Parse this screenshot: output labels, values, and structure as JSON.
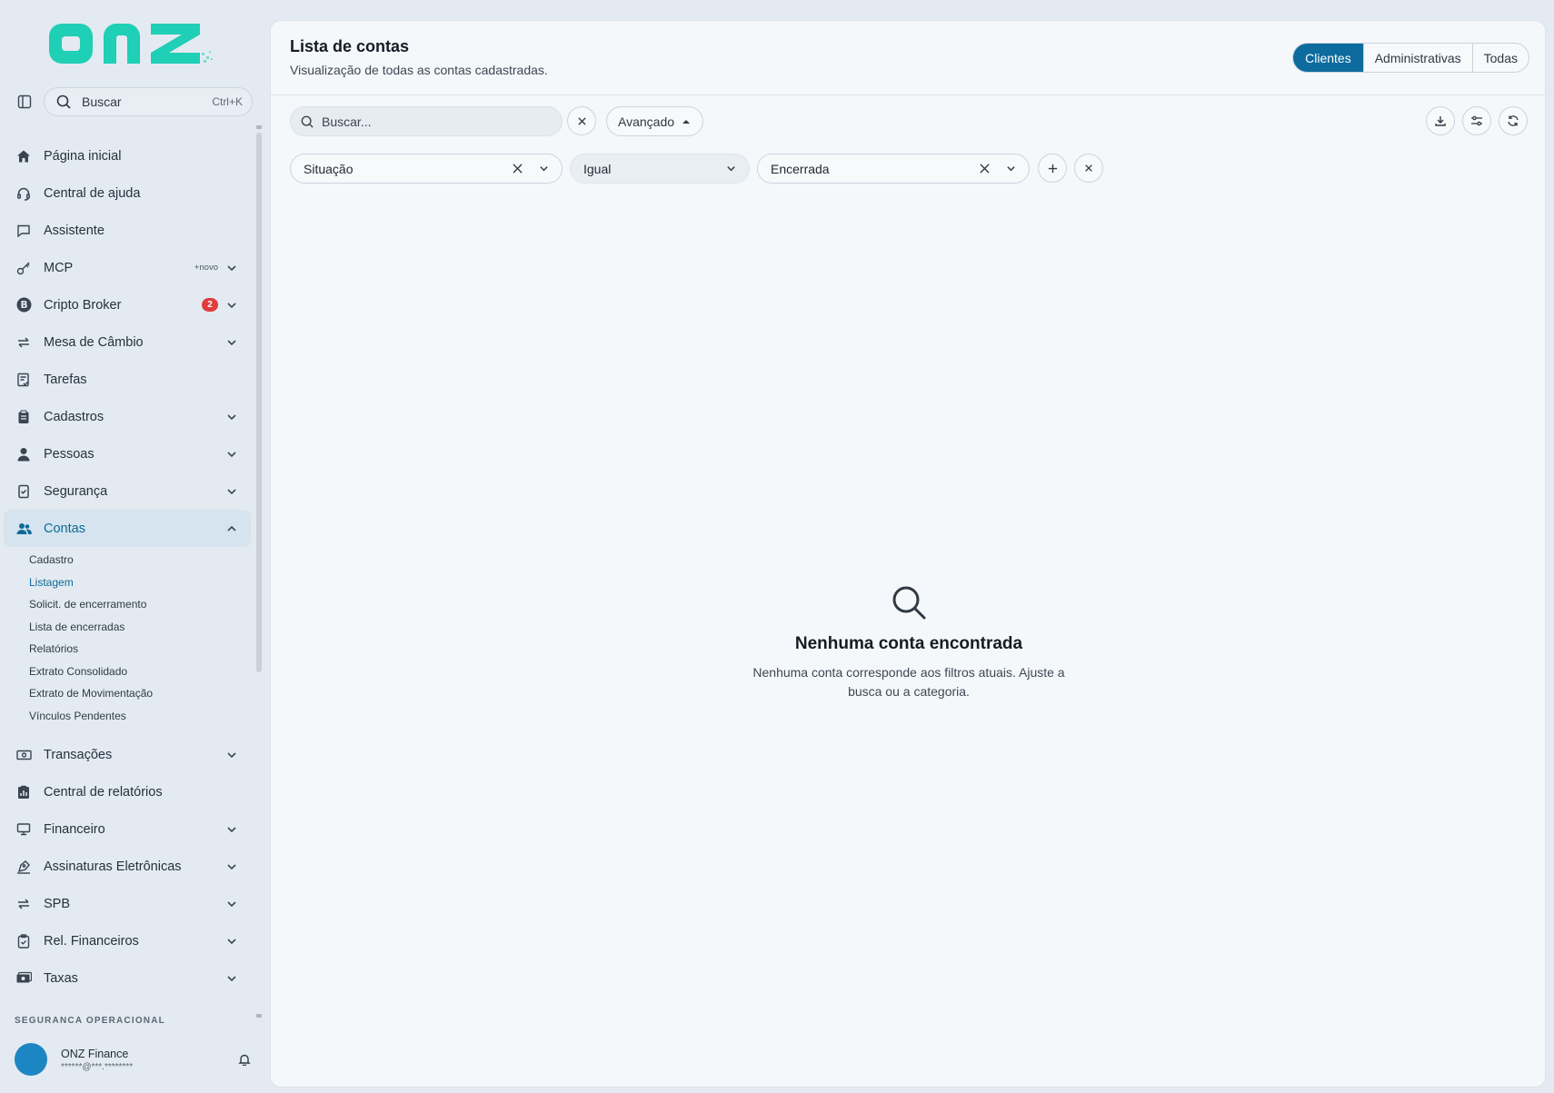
{
  "brand": {
    "logo_text": "onz",
    "accent": "#1fcfb6"
  },
  "sidebar": {
    "search": {
      "label": "Buscar",
      "shortcut": "Ctrl+K"
    },
    "items": [
      {
        "label": "Página inicial",
        "icon": "home-icon"
      },
      {
        "label": "Central de ajuda",
        "icon": "headset-icon"
      },
      {
        "label": "Assistente",
        "icon": "chat-icon"
      },
      {
        "label": "MCP",
        "icon": "key-icon",
        "tag": "+novo"
      },
      {
        "label": "Cripto Broker",
        "icon": "bitcoin-icon",
        "badge": "2"
      },
      {
        "label": "Mesa de Câmbio",
        "icon": "exchange-icon"
      },
      {
        "label": "Tarefas",
        "icon": "tasks-icon"
      },
      {
        "label": "Cadastros",
        "icon": "clipboard-icon"
      },
      {
        "label": "Pessoas",
        "icon": "person-icon"
      },
      {
        "label": "Segurança",
        "icon": "shield-icon"
      },
      {
        "label": "Contas",
        "icon": "users-icon"
      }
    ],
    "contas_sub": [
      "Cadastro",
      "Listagem",
      "Solicit. de encerramento",
      "Lista de encerradas",
      "Relatórios",
      "Extrato Consolidado",
      "Extrato de Movimentação",
      "Vínculos Pendentes"
    ],
    "items_after": [
      {
        "label": "Transações",
        "icon": "cash-icon"
      },
      {
        "label": "Central de relatórios",
        "icon": "report-icon"
      },
      {
        "label": "Financeiro",
        "icon": "finance-icon"
      },
      {
        "label": "Assinaturas Eletrônicas",
        "icon": "signature-icon"
      },
      {
        "label": "SPB",
        "icon": "exchange-icon"
      },
      {
        "label": "Rel. Financeiros",
        "icon": "clipboard-check-icon"
      },
      {
        "label": "Taxas",
        "icon": "money-icon"
      }
    ],
    "section_label": "SEGURANÇA OPERACIONAL",
    "user": {
      "name": "ONZ Finance",
      "email": "******@***.********"
    }
  },
  "header": {
    "title": "Lista de contas",
    "subtitle": "Visualização de todas as contas cadastradas.",
    "segments": [
      "Clientes",
      "Administrativas",
      "Todas"
    ],
    "selected_segment": "Clientes"
  },
  "toolbar": {
    "search_placeholder": "Buscar...",
    "advanced_label": "Avançado"
  },
  "filters": {
    "field": "Situação",
    "operator": "Igual",
    "value": "Encerrada"
  },
  "empty_state": {
    "title": "Nenhuma conta encontrada",
    "description": "Nenhuma conta corresponde aos filtros atuais. Ajuste a busca ou a categoria."
  },
  "colors": {
    "primary": "#0d6b9e",
    "active_bg": "#d5e4ee",
    "badge": "#e03c3c",
    "avatar": "#1c86c2"
  }
}
